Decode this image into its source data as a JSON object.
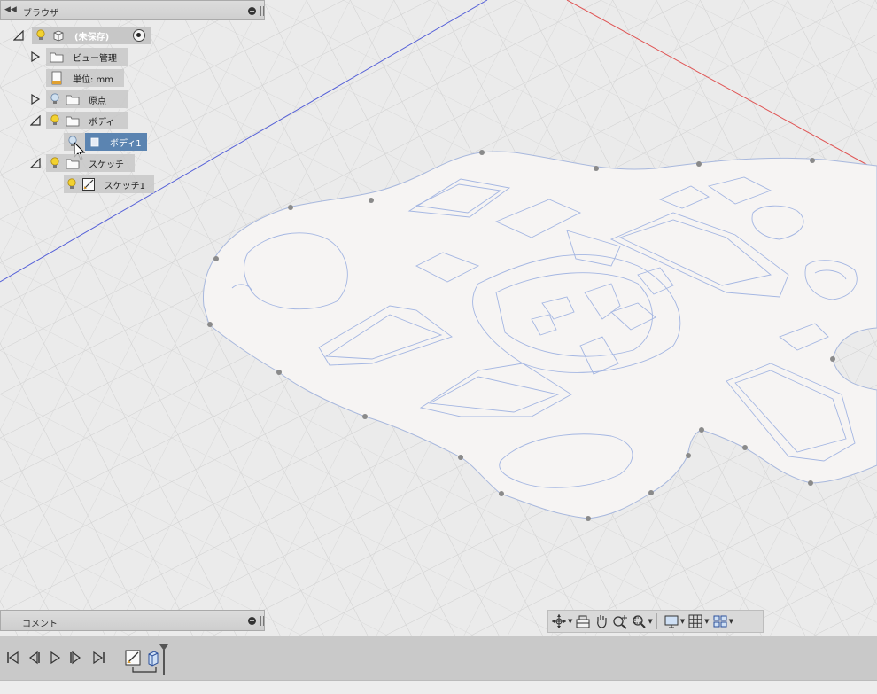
{
  "browser": {
    "collapse_icon": "double-left-chevron-icon",
    "title": "ブラウザ",
    "tree": {
      "root": {
        "label": "(未保存)"
      },
      "view_management": {
        "label": "ビュー管理"
      },
      "units": {
        "label": "単位: mm"
      },
      "origin": {
        "label": "原点"
      },
      "bodies": {
        "label": "ボディ"
      },
      "body1": {
        "label": "ボディ1"
      },
      "sketches": {
        "label": "スケッチ"
      },
      "sketch1": {
        "label": "スケッチ1"
      }
    }
  },
  "comments": {
    "title": "コメント"
  },
  "nav_toolbar": {
    "items": [
      "orbit-icon",
      "look-at-icon",
      "pan-icon",
      "zoom-icon",
      "fit-icon",
      "display-settings-icon",
      "grid-settings-icon",
      "viewports-icon"
    ]
  },
  "timeline": {
    "controls": [
      "go-to-start-icon",
      "step-back-icon",
      "play-icon",
      "step-forward-icon",
      "go-to-end-icon"
    ],
    "features": [
      "sketch-feature-icon",
      "extrude-feature-icon"
    ]
  },
  "colors": {
    "selection": "#5b84b1",
    "panel_bg": "#c8c8c8",
    "grid_line": "#c8c8c8",
    "axis_x": "#e05555",
    "axis_z": "#5560d8",
    "sketch_line": "#9ab0e0",
    "bulb_on": "#f2d230"
  }
}
